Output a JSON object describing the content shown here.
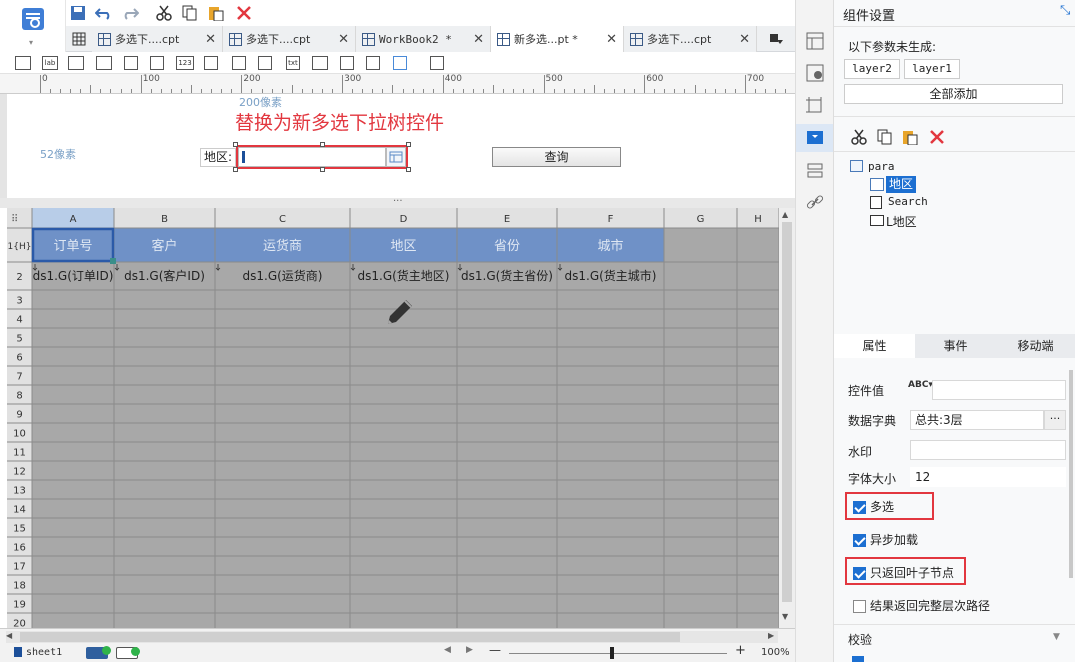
{
  "tabs": [
    {
      "label": "多选下....cpt",
      "active": false
    },
    {
      "label": "多选下....cpt",
      "active": false
    },
    {
      "label": "WorkBook2 *",
      "active": false
    },
    {
      "label": "新多选...pt *",
      "active": true
    },
    {
      "label": "多选下....cpt",
      "active": false
    }
  ],
  "widget_bar": [
    "lab",
    "123",
    "txt"
  ],
  "ruler_ticks": [
    "0",
    "100",
    "200",
    "300",
    "400",
    "500",
    "600",
    "700"
  ],
  "canvas": {
    "width_label": "200像素",
    "height_label": "52像素",
    "annotation": "替换为新多选下拉树控件",
    "field_label": "地区:",
    "query_button": "查询"
  },
  "grid": {
    "corner": "⠿",
    "columns": [
      "A",
      "B",
      "C",
      "D",
      "E",
      "F",
      "G",
      "H"
    ],
    "row_labels": [
      "1{H}",
      "2",
      "3",
      "4",
      "5",
      "6",
      "7",
      "8",
      "9",
      "10",
      "11",
      "12",
      "13",
      "14",
      "15",
      "16",
      "17",
      "18",
      "19",
      "20"
    ],
    "header_row": [
      "订单号",
      "客户",
      "运货商",
      "地区",
      "省份",
      "城市"
    ],
    "data_row": [
      "ds1.G(订单ID)",
      "ds1.G(客户ID)",
      "ds1.G(运货商)",
      "ds1.G(货主地区)",
      "ds1.G(货主省份)",
      "ds1.G(货主城市)"
    ]
  },
  "bottom": {
    "sheet": "sheet1",
    "zoom": "100%",
    "minus": "—",
    "plus": "+"
  },
  "panel": {
    "title": "组件设置",
    "unbuilt_label": "以下参数未生成:",
    "unbuilt_params": [
      "layer2",
      "layer1"
    ],
    "add_all": "全部添加",
    "tree_root": "para",
    "tree_items": [
      "地区",
      "Search",
      "L地区"
    ],
    "prop_tabs": [
      "属性",
      "事件",
      "移动端"
    ],
    "props": {
      "control_value": "控件值",
      "dictionary": "数据字典",
      "dictionary_value": "总共:3层",
      "watermark": "水印",
      "font_size_label": "字体大小",
      "font_size": "12",
      "multi_select": "多选",
      "async_load": "异步加载",
      "leaf_only": "只返回叶子节点",
      "full_path": "结果返回完整层次路径",
      "validate": "校验",
      "ellipsis": "···"
    }
  },
  "colors": {
    "accent": "#1c6fd1",
    "header_fill": "#6f91c7",
    "grid_fill": "#a8a8a8",
    "red": "#e2373f"
  }
}
